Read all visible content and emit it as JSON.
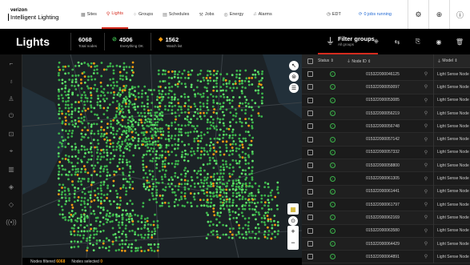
{
  "brand": {
    "line1": "verizon",
    "line2": "Intelligent Lighting"
  },
  "nav": {
    "items": [
      {
        "label": "Sites",
        "icon": "grid-icon"
      },
      {
        "label": "Lights",
        "icon": "pin-icon",
        "active": true
      },
      {
        "label": "Groups",
        "icon": "groups-icon"
      },
      {
        "label": "Schedules",
        "icon": "calendar-icon"
      },
      {
        "label": "Jobs",
        "icon": "wrench-icon"
      },
      {
        "label": "Energy",
        "icon": "energy-icon"
      },
      {
        "label": "Alarms",
        "icon": "bell-icon"
      }
    ],
    "timezone": "EDT",
    "jobs_running": "0 jobs running"
  },
  "page": {
    "title": "Lights",
    "stats": [
      {
        "value": "6068",
        "label": "Total nodes"
      },
      {
        "value": "4506",
        "label": "Everything OK"
      },
      {
        "value": "1562",
        "label": "Watch list"
      }
    ],
    "filter": {
      "title": "Filter groups",
      "sub": "All groups"
    }
  },
  "table": {
    "headers": {
      "status": "Status",
      "node": "Node ID",
      "model": "Model"
    },
    "rows": [
      {
        "node": "015322000046125",
        "model": "Light Sense Node"
      },
      {
        "node": "015322000050097",
        "model": "Light Sense Node"
      },
      {
        "node": "015322000053085",
        "model": "Light Sense Node"
      },
      {
        "node": "015322000056219",
        "model": "Light Sense Node"
      },
      {
        "node": "015322000056748",
        "model": "Light Sense Node"
      },
      {
        "node": "015322000057142",
        "model": "Light Sense Node"
      },
      {
        "node": "015322000057332",
        "model": "Light Sense Node"
      },
      {
        "node": "015322000058800",
        "model": "Light Sense Node"
      },
      {
        "node": "015322000061305",
        "model": "Light Sense Node"
      },
      {
        "node": "015322000061441",
        "model": "Light Sense Node"
      },
      {
        "node": "015322000061797",
        "model": "Light Sense Node"
      },
      {
        "node": "015322000062169",
        "model": "Light Sense Node"
      },
      {
        "node": "015322000063580",
        "model": "Light Sense Node"
      },
      {
        "node": "015322000064429",
        "model": "Light Sense Node"
      },
      {
        "node": "015322000064891",
        "model": "Light Sense Node"
      }
    ]
  },
  "footer": {
    "filtered_label": "Nodes filtered",
    "filtered_value": "6068",
    "selected_label": "Nodes selected",
    "selected_value": "0"
  },
  "colors": {
    "accent": "#d52b1e",
    "ok": "#3cb44b",
    "warn": "#f39c12",
    "jobs": "#1d66d3"
  }
}
